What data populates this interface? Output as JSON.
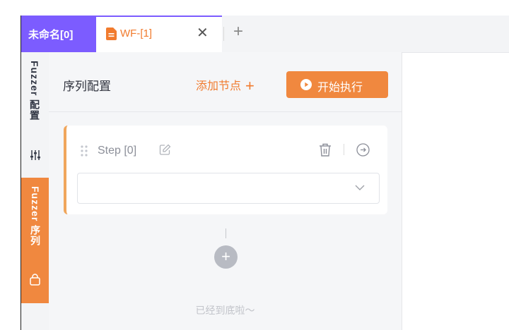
{
  "tabs": {
    "group_label": "未命名[0]",
    "active_label": "WF-[1]",
    "close_glyph": "✕",
    "add_glyph": "+"
  },
  "sidebar": {
    "config_label": "Fuzzer 配置",
    "sequence_label": "Fuzzer 序列"
  },
  "panel": {
    "title": "序列配置",
    "add_node_label": "添加节点",
    "add_node_glyph": "+",
    "run_label": "开始执行",
    "bottom_note": "已经到底啦～"
  },
  "step": {
    "label": "Step [0]",
    "select_value": ""
  },
  "add_step_glyph": "+",
  "colors": {
    "accent_purple": "#7c5cff",
    "accent_orange": "#f0883f"
  },
  "icons": [
    "file-icon",
    "close-icon",
    "plus-icon",
    "settings-sliders-icon",
    "bag-icon",
    "play-icon",
    "drag-handle-icon",
    "edit-icon",
    "trash-icon",
    "goto-icon",
    "chevron-down-icon"
  ]
}
